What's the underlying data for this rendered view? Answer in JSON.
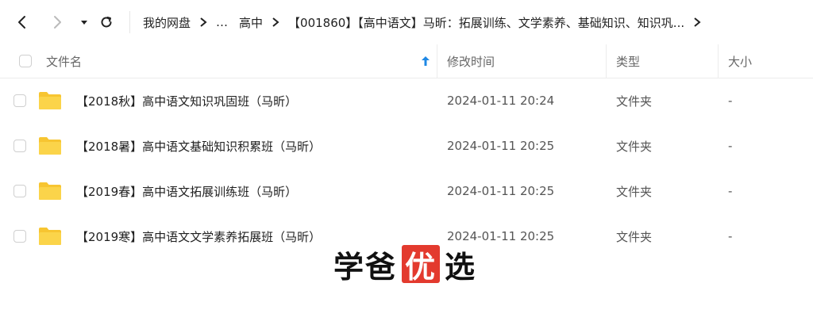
{
  "toolbar": {
    "back_icon": "chevron-left-icon",
    "forward_icon": "chevron-right-icon",
    "history_icon": "caret-down-icon",
    "refresh_icon": "refresh-icon"
  },
  "breadcrumb": {
    "items": [
      "我的网盘",
      "…",
      "高中",
      "【001860】【高中语文】马昕：拓展训练、文学素养、基础知识、知识巩..."
    ]
  },
  "table": {
    "columns": {
      "name": "文件名",
      "modified": "修改时间",
      "type": "类型",
      "size": "大小"
    },
    "sort_icon": "arrow-up-icon",
    "rows": [
      {
        "name": "【2018秋】高中语文知识巩固班（马昕）",
        "modified": "2024-01-11 20:24",
        "type": "文件夹",
        "size": "-"
      },
      {
        "name": "【2018暑】高中语文基础知识积累班（马昕）",
        "modified": "2024-01-11 20:25",
        "type": "文件夹",
        "size": "-"
      },
      {
        "name": "【2019春】高中语文拓展训练班（马昕）",
        "modified": "2024-01-11 20:25",
        "type": "文件夹",
        "size": "-"
      },
      {
        "name": "【2019寒】高中语文文学素养拓展班（马昕）",
        "modified": "2024-01-11 20:25",
        "type": "文件夹",
        "size": "-"
      }
    ]
  },
  "watermark": {
    "part1": "学爸",
    "highlight": "优",
    "part2": "选"
  },
  "colors": {
    "accent": "#1e88e5",
    "folder": "#f7c531",
    "watermark_box": "#e33a2e"
  }
}
